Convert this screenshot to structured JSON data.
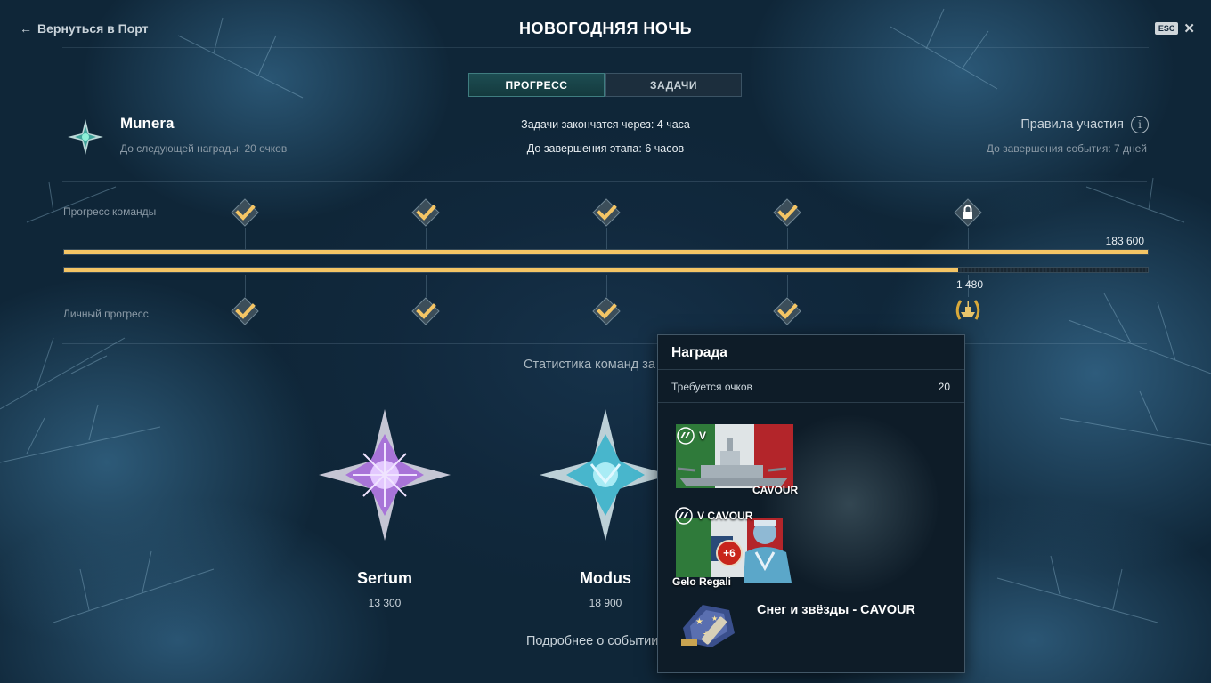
{
  "header": {
    "back_label": "Вернуться в Порт",
    "title": "НОВОГОДНЯЯ НОЧЬ",
    "esc_key": "ESC"
  },
  "tabs": [
    {
      "label": "ПРОГРЕСС",
      "active": true
    },
    {
      "label": "ЗАДАЧИ",
      "active": false
    }
  ],
  "player": {
    "team_name": "Munera",
    "next_reward": "До следующей награды: 20 очков"
  },
  "timers": {
    "tasks_end": "Задачи закончатся через: 4 часа",
    "stage_end": "До завершения этапа: 6 часов"
  },
  "rules": {
    "label": "Правила участия",
    "event_end": "До завершения события: 7 дней"
  },
  "progress": {
    "team_label": "Прогресс команды",
    "personal_label": "Личный прогресс",
    "team_value": "183 600",
    "personal_value": "1 480",
    "team_fraction": 1.0,
    "personal_fraction": 0.825,
    "team_milestones": [
      "check",
      "check",
      "check",
      "check",
      "lock"
    ],
    "personal_milestones": [
      "check",
      "check",
      "check",
      "check",
      "reward"
    ]
  },
  "stats": {
    "title": "Статистика команд за",
    "teams": [
      {
        "name": "Sertum",
        "score": "13 300"
      },
      {
        "name": "Modus",
        "score": "18 900"
      }
    ]
  },
  "more_link": "Подробнее о событии",
  "tooltip": {
    "title": "Награда",
    "requirement_label": "Требуется очков",
    "requirement_value": "20",
    "ship_card": {
      "tier": "V",
      "name": "CAVOUR"
    },
    "commander_card": {
      "ship": "V CAVOUR",
      "bonus": "+6",
      "name": "Gelo Regali"
    },
    "camouflage": "Снег и звёзды - CAVOUR"
  },
  "colors": {
    "progress_gold": "#f4c565",
    "tab_active": "#1d4d52",
    "tooltip_bg": "#0e1c28"
  }
}
